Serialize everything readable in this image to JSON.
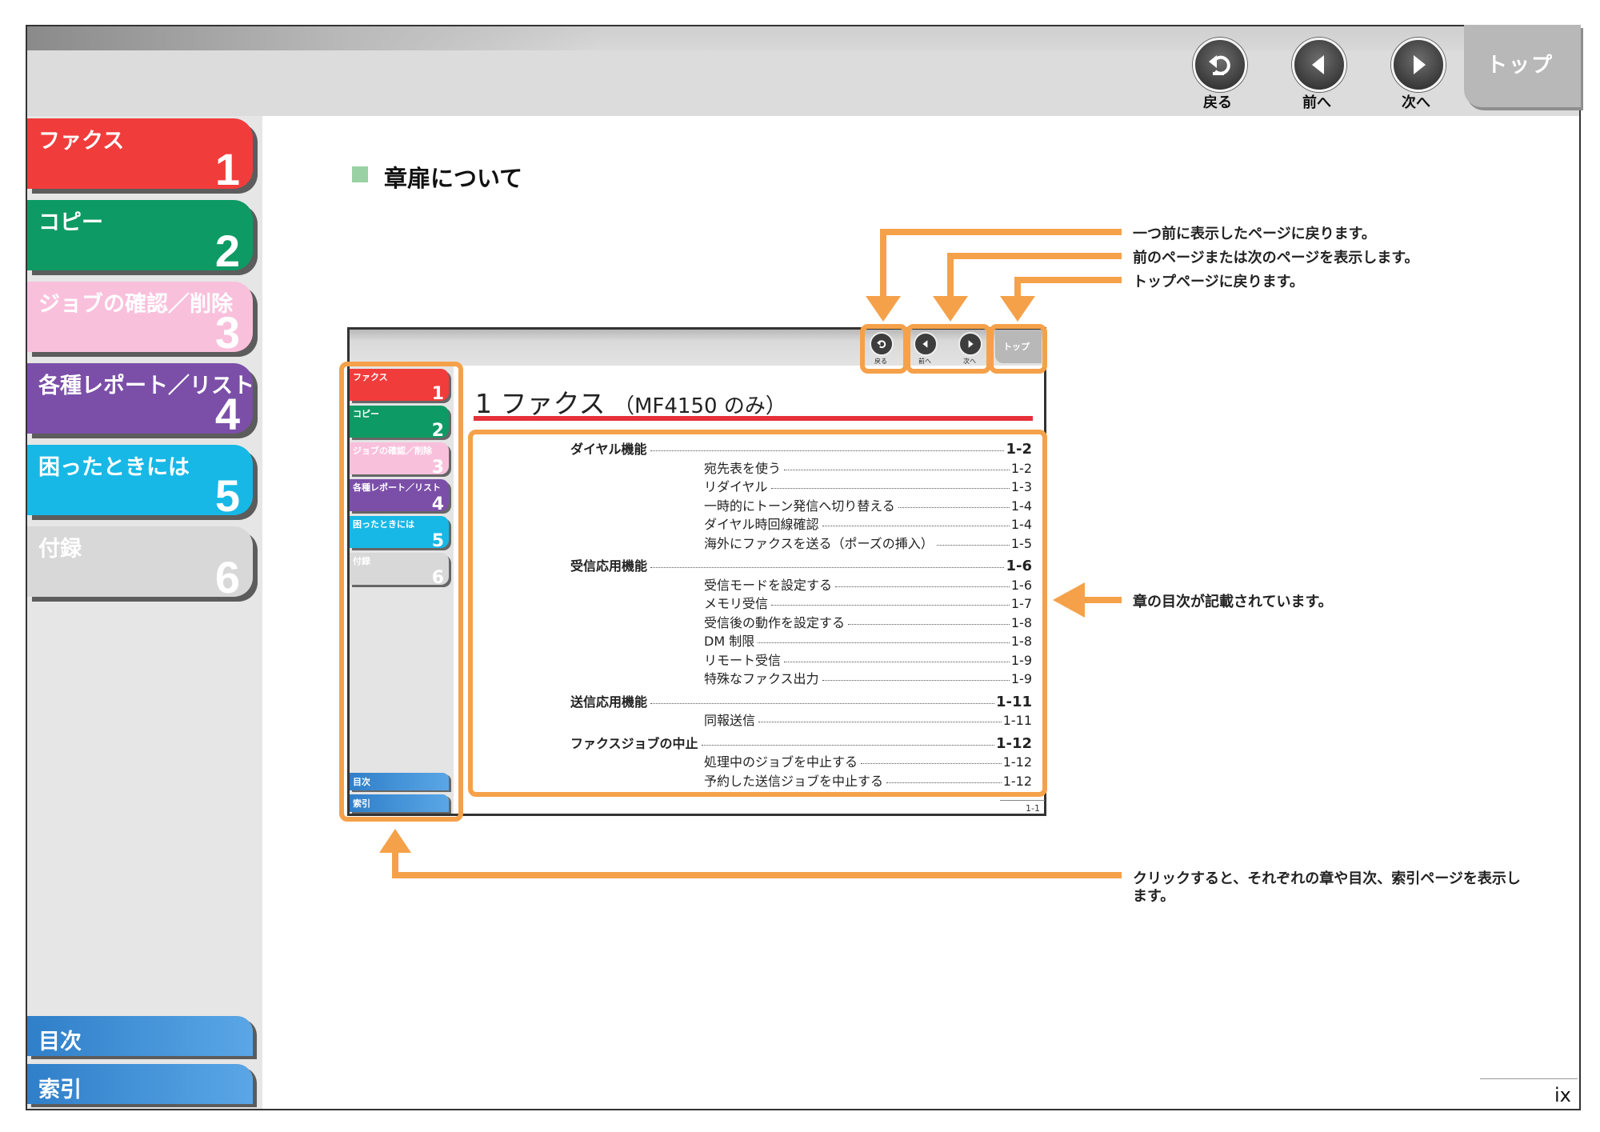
{
  "header": {
    "nav": [
      {
        "label": "戻る",
        "icon": "back-icon"
      },
      {
        "label": "前へ",
        "icon": "prev-icon"
      },
      {
        "label": "次へ",
        "icon": "next-icon"
      }
    ],
    "top_tab": "トップ"
  },
  "sidebar": {
    "chapters": [
      {
        "title": "ファクス",
        "number": "1",
        "color": "#f13c3c"
      },
      {
        "title": "コピー",
        "number": "2",
        "color": "#0e9a64"
      },
      {
        "title": "ジョブの確認／削除",
        "number": "3",
        "color": "#f9c0dc"
      },
      {
        "title": "各種レポート／リスト",
        "number": "4",
        "color": "#7b4fa8"
      },
      {
        "title": "困ったときには",
        "number": "5",
        "color": "#17b8e6"
      },
      {
        "title": "付録",
        "number": "6",
        "color": "#d8d8d8"
      }
    ],
    "contents": "目次",
    "index": "索引"
  },
  "main": {
    "heading": "章扉について",
    "notes": [
      "一つ前に表示したページに戻ります。",
      "前のページまたは次のページを表示します。",
      "トップページに戻ります。",
      "章の目次が記載されています。",
      "クリックすると、それぞれの章や目次、索引ページを表示し",
      "ます。"
    ],
    "page_number": "ix"
  },
  "mini_page": {
    "nav": [
      {
        "label": "戻る"
      },
      {
        "label": "前へ"
      },
      {
        "label": "次へ"
      }
    ],
    "top_tab": "トップ",
    "chapters": [
      {
        "title": "ファクス",
        "number": "1"
      },
      {
        "title": "コピー",
        "number": "2"
      },
      {
        "title": "ジョブの確認／削除",
        "number": "3"
      },
      {
        "title": "各種レポート／リスト",
        "number": "4"
      },
      {
        "title": "困ったときには",
        "number": "5"
      },
      {
        "title": "付録",
        "number": "6"
      }
    ],
    "contents": "目次",
    "index": "索引",
    "title": "1 ファクス",
    "title_sub": "（MF4150 のみ）",
    "toc": [
      {
        "label": "ダイヤル機能",
        "page": "1-2",
        "level": 1
      },
      {
        "label": "宛先表を使う",
        "page": "1-2",
        "level": 2
      },
      {
        "label": "リダイヤル",
        "page": "1-3",
        "level": 2
      },
      {
        "label": "一時的にトーン発信へ切り替える",
        "page": "1-4",
        "level": 2
      },
      {
        "label": "ダイヤル時回線確認",
        "page": "1-4",
        "level": 2
      },
      {
        "label": "海外にファクスを送る（ポーズの挿入）",
        "page": "1-5",
        "level": 2
      },
      {
        "label": "受信応用機能",
        "page": "1-6",
        "level": 1
      },
      {
        "label": "受信モードを設定する",
        "page": "1-6",
        "level": 2
      },
      {
        "label": "メモリ受信",
        "page": "1-7",
        "level": 2
      },
      {
        "label": "受信後の動作を設定する",
        "page": "1-8",
        "level": 2
      },
      {
        "label": "DM 制限",
        "page": "1-8",
        "level": 2
      },
      {
        "label": "リモート受信",
        "page": "1-9",
        "level": 2
      },
      {
        "label": "特殊なファクス出力",
        "page": "1-9",
        "level": 2
      },
      {
        "label": "送信応用機能",
        "page": "1-11",
        "level": 1
      },
      {
        "label": "同報送信",
        "page": "1-11",
        "level": 2
      },
      {
        "label": "ファクスジョブの中止",
        "page": "1-12",
        "level": 1
      },
      {
        "label": "処理中のジョブを中止する",
        "page": "1-12",
        "level": 2
      },
      {
        "label": "予約した送信ジョブを中止する",
        "page": "1-12",
        "level": 2
      }
    ],
    "page_number": "1-1"
  },
  "colors": {
    "highlight": "#f5a14a",
    "accent_green": "#9ad1a4",
    "title_rule": "#e6303a"
  }
}
